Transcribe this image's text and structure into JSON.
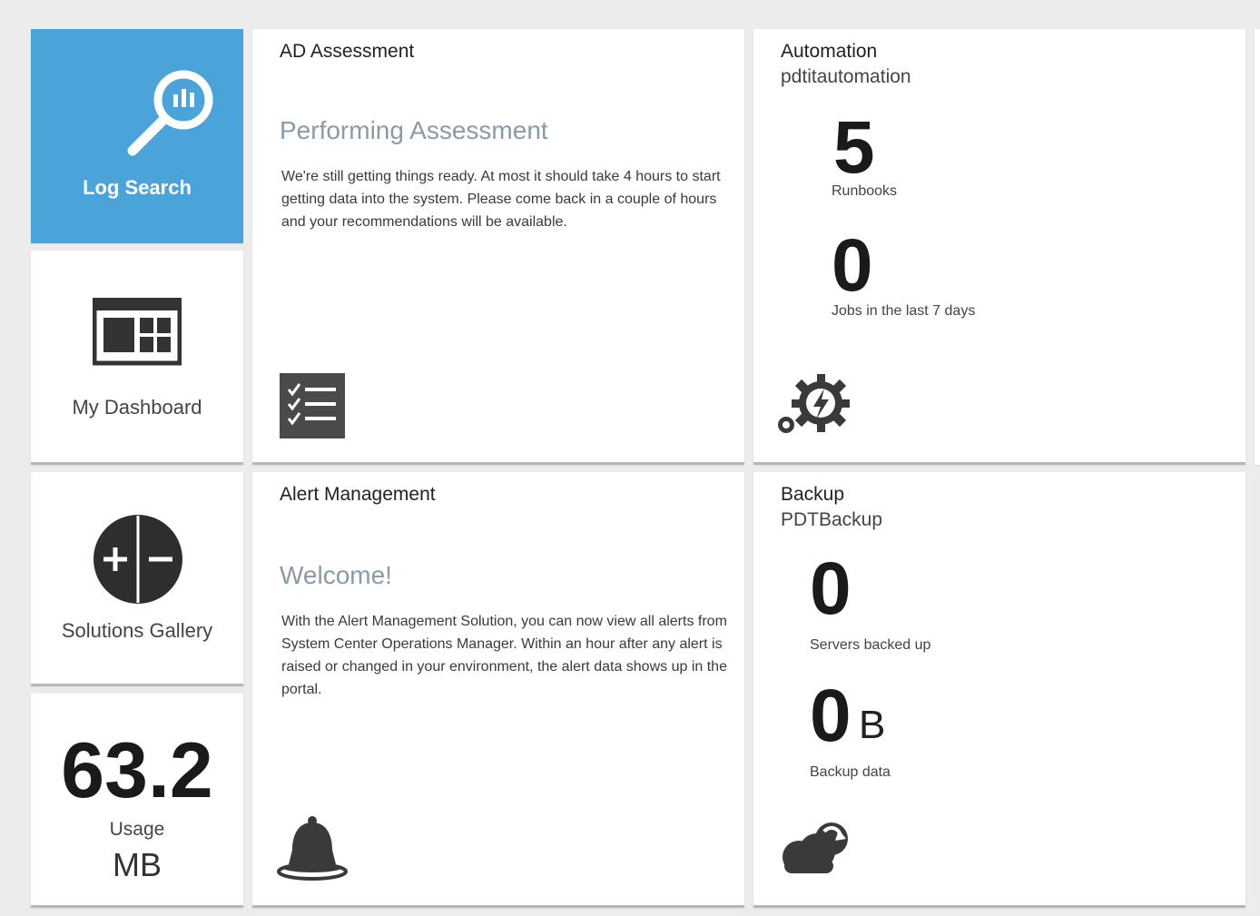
{
  "tiles": {
    "log_search": {
      "label": "Log Search",
      "icon": "log-search-icon"
    },
    "my_dashboard": {
      "label": "My Dashboard",
      "icon": "dashboard-icon"
    },
    "solutions_gallery": {
      "label": "Solutions Gallery",
      "icon": "solutions-gallery-icon"
    },
    "usage": {
      "value": "63.2",
      "label": "Usage",
      "unit": "MB"
    },
    "ad_assessment": {
      "title": "AD Assessment",
      "heading": "Performing Assessment",
      "body": "We're still getting things ready. At most it should take 4 hours to start getting data into the system. Please come back in a couple of hours and your recommendations will be available.",
      "icon": "checklist-icon"
    },
    "automation": {
      "title": "Automation",
      "subtitle": "pdtitautomation",
      "runbooks_value": "5",
      "runbooks_label": "Runbooks",
      "jobs_value": "0",
      "jobs_label": "Jobs in the last 7 days",
      "icon": "automation-gear-icon"
    },
    "alert_management": {
      "title": "Alert Management",
      "heading": "Welcome!",
      "body": "With the Alert Management Solution, you can now view all alerts from System Center Operations Manager. Within an hour after any alert is raised or changed in your environment, the alert data shows up in the portal.",
      "icon": "bell-icon"
    },
    "backup": {
      "title": "Backup",
      "subtitle": "PDTBackup",
      "servers_value": "0",
      "servers_label": "Servers backed up",
      "data_value": "0",
      "data_unit": "B",
      "data_label": "Backup data",
      "icon": "cloud-backup-icon"
    }
  },
  "colors": {
    "accent_blue": "#4aa3d9",
    "heading_gray": "#8a9aa6",
    "icon_dark": "#3a3a3a"
  }
}
